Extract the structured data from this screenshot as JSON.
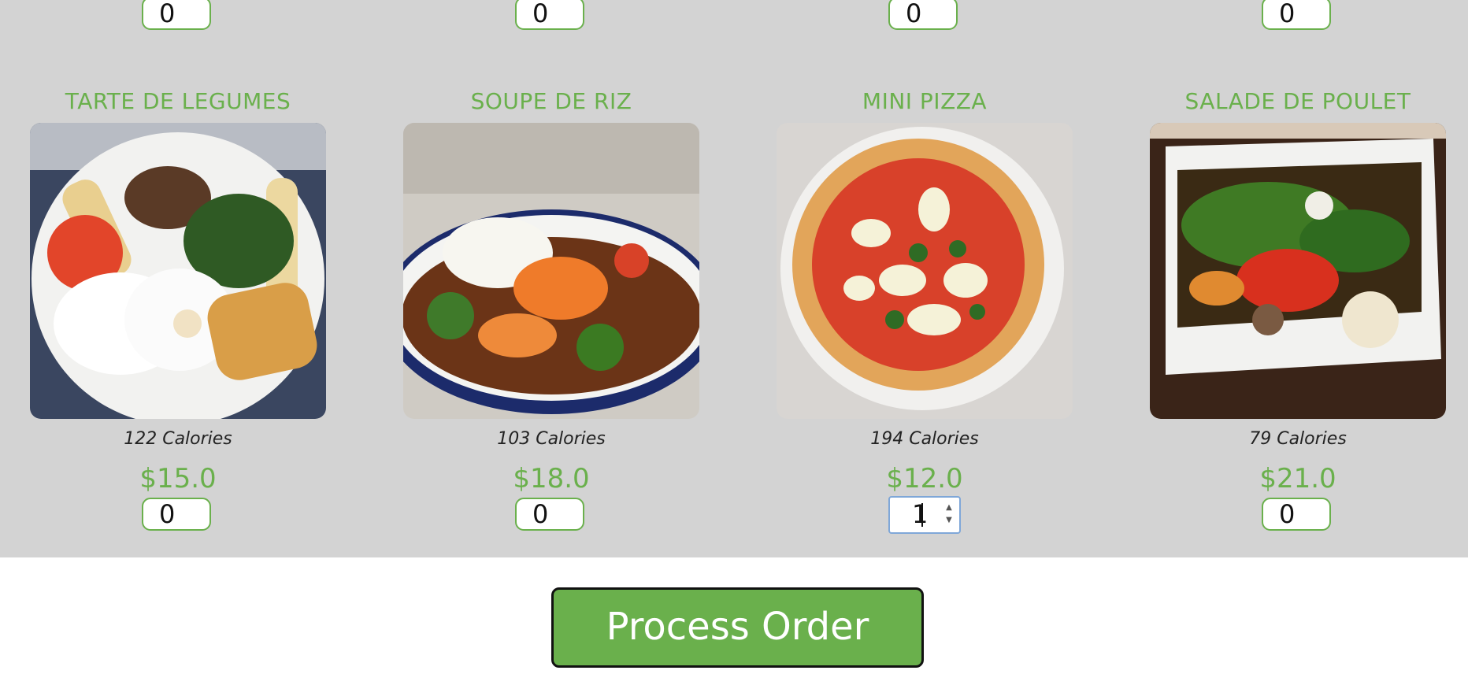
{
  "top_quantities": [
    "0",
    "0",
    "0",
    "0"
  ],
  "dishes": [
    {
      "name": "TARTE DE LEGUMES",
      "calories": "122 Calories",
      "price": "$15.0",
      "quantity": "0",
      "image": "breakfast-plate-photo"
    },
    {
      "name": "SOUPE DE RIZ",
      "calories": "103 Calories",
      "price": "$18.0",
      "quantity": "0",
      "image": "shrimp-rice-stew-photo"
    },
    {
      "name": "MINI PIZZA",
      "calories": "194 Calories",
      "price": "$12.0",
      "quantity": "1",
      "image": "margherita-pizza-photo"
    },
    {
      "name": "SALADE DE POULET",
      "calories": "79 Calories",
      "price": "$21.0",
      "quantity": "0",
      "image": "chicken-vegetable-salad-photo"
    }
  ],
  "order_button": "Process Order",
  "colors": {
    "accent": "#6ab04c",
    "panel_bg": "#d3d3d3",
    "active_border": "#7fa7d8"
  }
}
